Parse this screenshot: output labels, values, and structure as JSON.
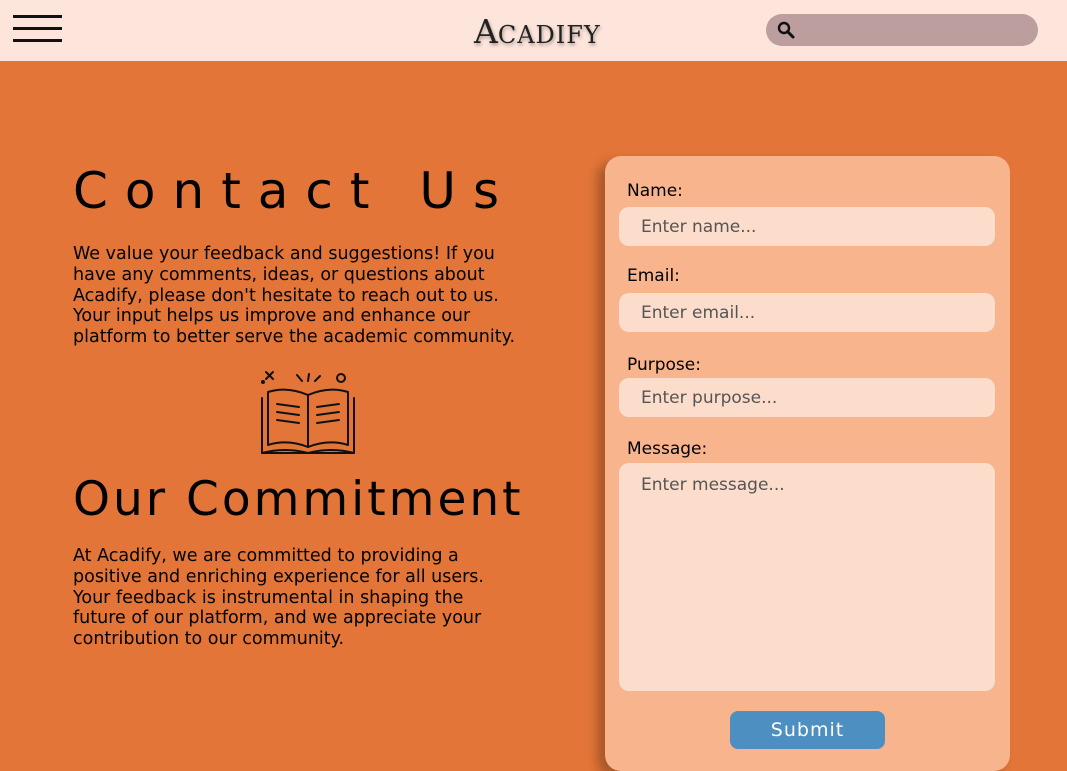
{
  "header": {
    "brand_initial": "A",
    "brand_rest": "CADIFY",
    "search": {
      "placeholder": "",
      "icon": "search-icon"
    },
    "menu_icon": "hamburger-menu-icon"
  },
  "contact": {
    "title": "Contact Us",
    "body": "We value your feedback and suggestions! If you\nhave any comments, ideas, or questions about\nAcadify, please don't hesitate to reach out to us.\nYour input helps us improve and enhance our\nplatform to better serve the academic community."
  },
  "illustration": {
    "icon": "open-book-icon"
  },
  "commitment": {
    "title": "Our Commitment",
    "body": "At Acadify, we are committed to providing a\npositive and enriching experience for all users.\nYour feedback is instrumental in shaping the\nfuture of our platform, and we appreciate your\ncontribution to our community."
  },
  "form": {
    "name": {
      "label": "Name:",
      "placeholder": "Enter name...",
      "value": ""
    },
    "email": {
      "label": "Email:",
      "placeholder": "Enter email...",
      "value": ""
    },
    "purpose": {
      "label": "Purpose:",
      "placeholder": "Enter purpose...",
      "value": ""
    },
    "message": {
      "label": "Message:",
      "placeholder": "Enter message...",
      "value": ""
    },
    "submit_label": "Submit"
  },
  "colors": {
    "page_background": "#e27537",
    "header_background": "#fde5dc",
    "search_background": "#bc9e9e",
    "card_background": "#f8b48d",
    "field_background": "#fcdccb",
    "submit_background": "#4d8fc0"
  }
}
